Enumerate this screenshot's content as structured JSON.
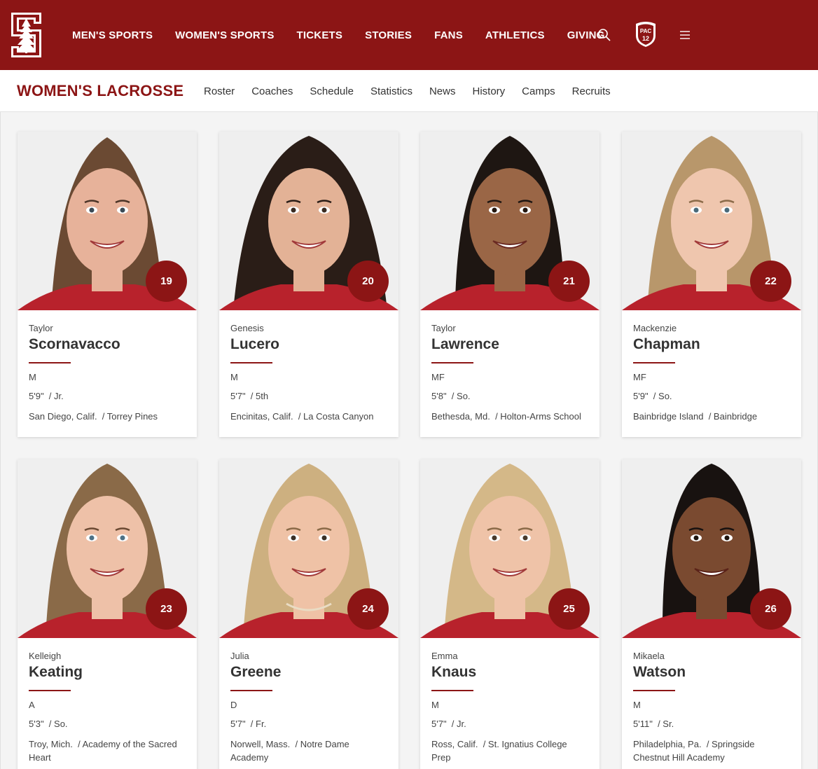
{
  "header": {
    "nav": [
      "MEN'S SPORTS",
      "WOMEN'S SPORTS",
      "TICKETS",
      "STORIES",
      "FANS",
      "ATHLETICS",
      "GIVING"
    ]
  },
  "subnav": {
    "title": "WOMEN'S LACROSSE",
    "links": [
      "Roster",
      "Coaches",
      "Schedule",
      "Statistics",
      "News",
      "History",
      "Camps",
      "Recruits"
    ]
  },
  "colors": {
    "brand": "#8c1515"
  },
  "players": [
    {
      "number": "19",
      "first": "Taylor",
      "last": "Scornavacco",
      "position": "M",
      "height": "5'9\"",
      "year": "/ Jr.",
      "hometown": "San Diego, Calif.",
      "school": "/ Torrey Pines"
    },
    {
      "number": "20",
      "first": "Genesis",
      "last": "Lucero",
      "position": "M",
      "height": "5'7\"",
      "year": "/ 5th",
      "hometown": "Encinitas, Calif.",
      "school": "/ La Costa Canyon"
    },
    {
      "number": "21",
      "first": "Taylor",
      "last": "Lawrence",
      "position": "MF",
      "height": "5'8\"",
      "year": "/ So.",
      "hometown": "Bethesda, Md.",
      "school": "/ Holton-Arms School"
    },
    {
      "number": "22",
      "first": "Mackenzie",
      "last": "Chapman",
      "position": "MF",
      "height": "5'9\"",
      "year": "/ So.",
      "hometown": "Bainbridge Island",
      "school": "/ Bainbridge"
    },
    {
      "number": "23",
      "first": "Kelleigh",
      "last": "Keating",
      "position": "A",
      "height": "5'3\"",
      "year": "/ So.",
      "hometown": "Troy, Mich.",
      "school": "/ Academy of the Sacred Heart"
    },
    {
      "number": "24",
      "first": "Julia",
      "last": "Greene",
      "position": "D",
      "height": "5'7\"",
      "year": "/ Fr.",
      "hometown": "Norwell, Mass.",
      "school": "/ Notre Dame Academy"
    },
    {
      "number": "25",
      "first": "Emma",
      "last": "Knaus",
      "position": "M",
      "height": "5'7\"",
      "year": "/ Jr.",
      "hometown": "Ross, Calif.",
      "school": "/ St. Ignatius College Prep"
    },
    {
      "number": "26",
      "first": "Mikaela",
      "last": "Watson",
      "position": "M",
      "height": "5'11\"",
      "year": "/ Sr.",
      "hometown": "Philadelphia, Pa.",
      "school": "/ Springside Chestnut Hill Academy"
    }
  ],
  "photo_style": [
    {
      "skin": "#e7b29a",
      "hair": "#6b4a33"
    },
    {
      "skin": "#e3b296",
      "hair": "#2a1d17"
    },
    {
      "skin": "#9a6646",
      "hair": "#1e1612"
    },
    {
      "skin": "#efc6ae",
      "hair": "#b8976b"
    },
    {
      "skin": "#eec1a8",
      "hair": "#8a6a48"
    },
    {
      "skin": "#efc2a6",
      "hair": "#cdb080"
    },
    {
      "skin": "#efc3a8",
      "hair": "#d4b888"
    },
    {
      "skin": "#7a4a30",
      "hair": "#181210"
    }
  ]
}
